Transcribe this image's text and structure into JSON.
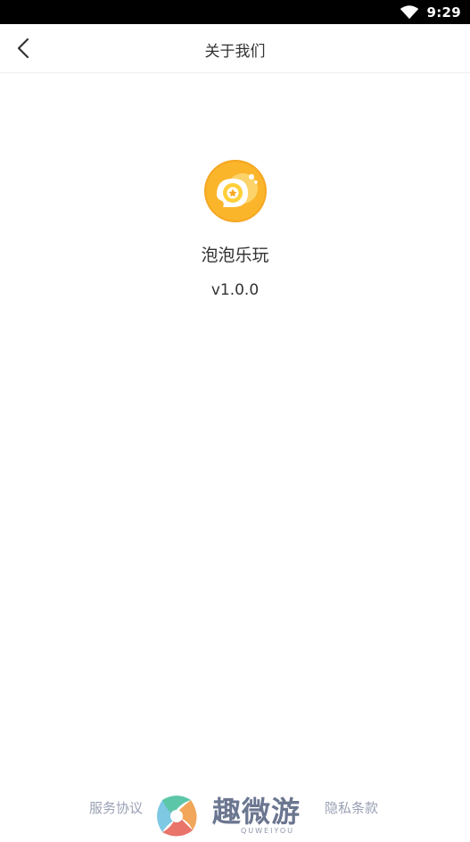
{
  "status_bar": {
    "time": "9:29"
  },
  "nav": {
    "title": "关于我们"
  },
  "app": {
    "name": "泡泡乐玩",
    "version": "v1.0.0"
  },
  "footer": {
    "service_agreement": "服务协议",
    "privacy_policy": "隐私条款",
    "watermark_text": "趣微游",
    "watermark_sub": "QUWEIYOU"
  },
  "colors": {
    "logo_orange": "#f5a623",
    "logo_yellow": "#ffd54a",
    "footer_link": "#9aa0b4"
  },
  "icons": {
    "back": "chevron-left-icon",
    "wifi": "wifi-icon",
    "app_logo": "bubble-logo-icon",
    "watermark_logo": "quweiyou-logo-icon"
  }
}
